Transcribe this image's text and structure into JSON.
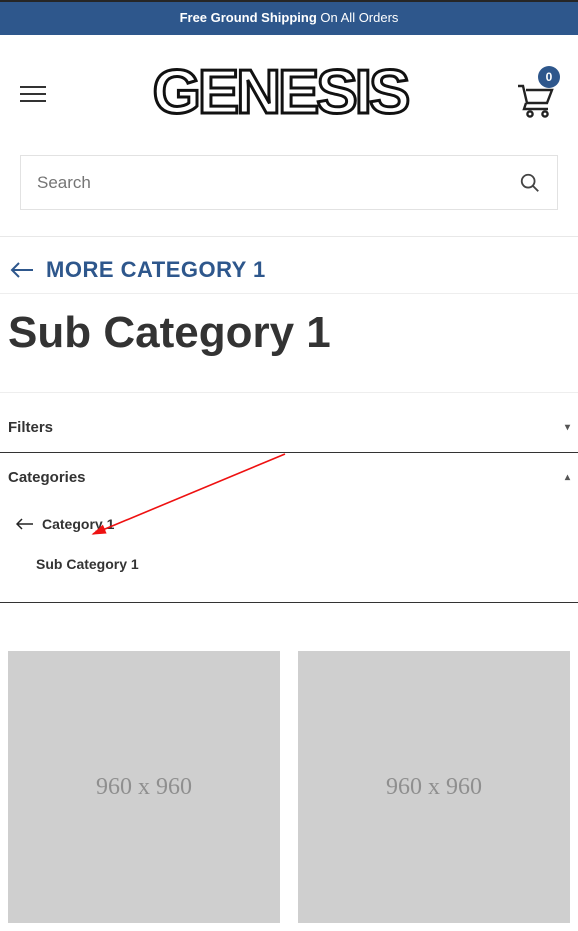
{
  "promo": {
    "bold": "Free Ground Shipping",
    "rest": " On All Orders"
  },
  "logo_text": "GENESIS",
  "cart": {
    "count": "0"
  },
  "search": {
    "placeholder": "Search"
  },
  "breadcrumb_back": {
    "label": "MORE CATEGORY 1"
  },
  "page_title": "Sub Category 1",
  "filters_section": {
    "label": "Filters"
  },
  "categories_section": {
    "label": "Categories"
  },
  "categories": {
    "parent": "Category 1",
    "current": "Sub Category 1"
  },
  "products": [
    {
      "placeholder": "960 x 960"
    },
    {
      "placeholder": "960 x 960"
    }
  ]
}
